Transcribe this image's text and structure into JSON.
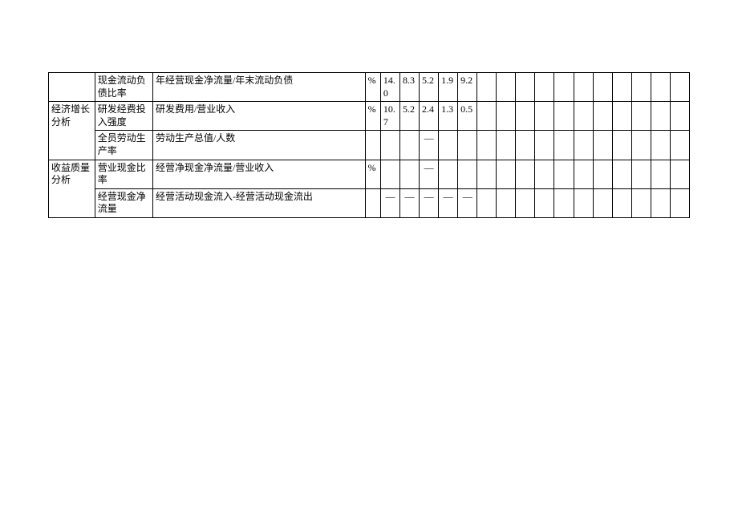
{
  "rows": [
    {
      "category": "",
      "metric": "现金流动负债比率",
      "formula": "年经营现金净流量/年末流动负债",
      "unit": "%",
      "v1": "14.0",
      "v2": "8.3",
      "v3": "5.2",
      "v4": "1.9",
      "v5": "9.2",
      "v6": "",
      "v7": "",
      "v8": "",
      "v9": "",
      "v10": "",
      "v11": "",
      "v12": "",
      "v13": "",
      "v14": "",
      "v15": "",
      "v16": ""
    },
    {
      "category": "经济增长分析",
      "metric": "研发经费投入强度",
      "formula": "研发费用/营业收入",
      "unit": "%",
      "v1": "10.7",
      "v2": "5.2",
      "v3": "2.4",
      "v4": "1.3",
      "v5": "0.5",
      "v6": "",
      "v7": "",
      "v8": "",
      "v9": "",
      "v10": "",
      "v11": "",
      "v12": "",
      "v13": "",
      "v14": "",
      "v15": "",
      "v16": ""
    },
    {
      "category": "",
      "metric": "全员劳动生产率",
      "formula": "劳动生产总值/人数",
      "unit": "",
      "v1": "",
      "v2": "",
      "v3": "—",
      "v4": "",
      "v5": "",
      "v6": "",
      "v7": "",
      "v8": "",
      "v9": "",
      "v10": "",
      "v11": "",
      "v12": "",
      "v13": "",
      "v14": "",
      "v15": "",
      "v16": ""
    },
    {
      "category": "收益质量分析",
      "metric": "营业现金比率",
      "formula": "经营净现金净流量/营业收入",
      "unit": "%",
      "v1": "",
      "v2": "",
      "v3": "—",
      "v4": "",
      "v5": "",
      "v6": "",
      "v7": "",
      "v8": "",
      "v9": "",
      "v10": "",
      "v11": "",
      "v12": "",
      "v13": "",
      "v14": "",
      "v15": "",
      "v16": ""
    },
    {
      "category": "",
      "metric": "经营现金净流量",
      "formula": "经营活动现金流入-经营活动现金流出",
      "unit": "",
      "v1": "—",
      "v2": "—",
      "v3": "—",
      "v4": "—",
      "v5": "—",
      "v6": "",
      "v7": "",
      "v8": "",
      "v9": "",
      "v10": "",
      "v11": "",
      "v12": "",
      "v13": "",
      "v14": "",
      "v15": "",
      "v16": ""
    }
  ]
}
